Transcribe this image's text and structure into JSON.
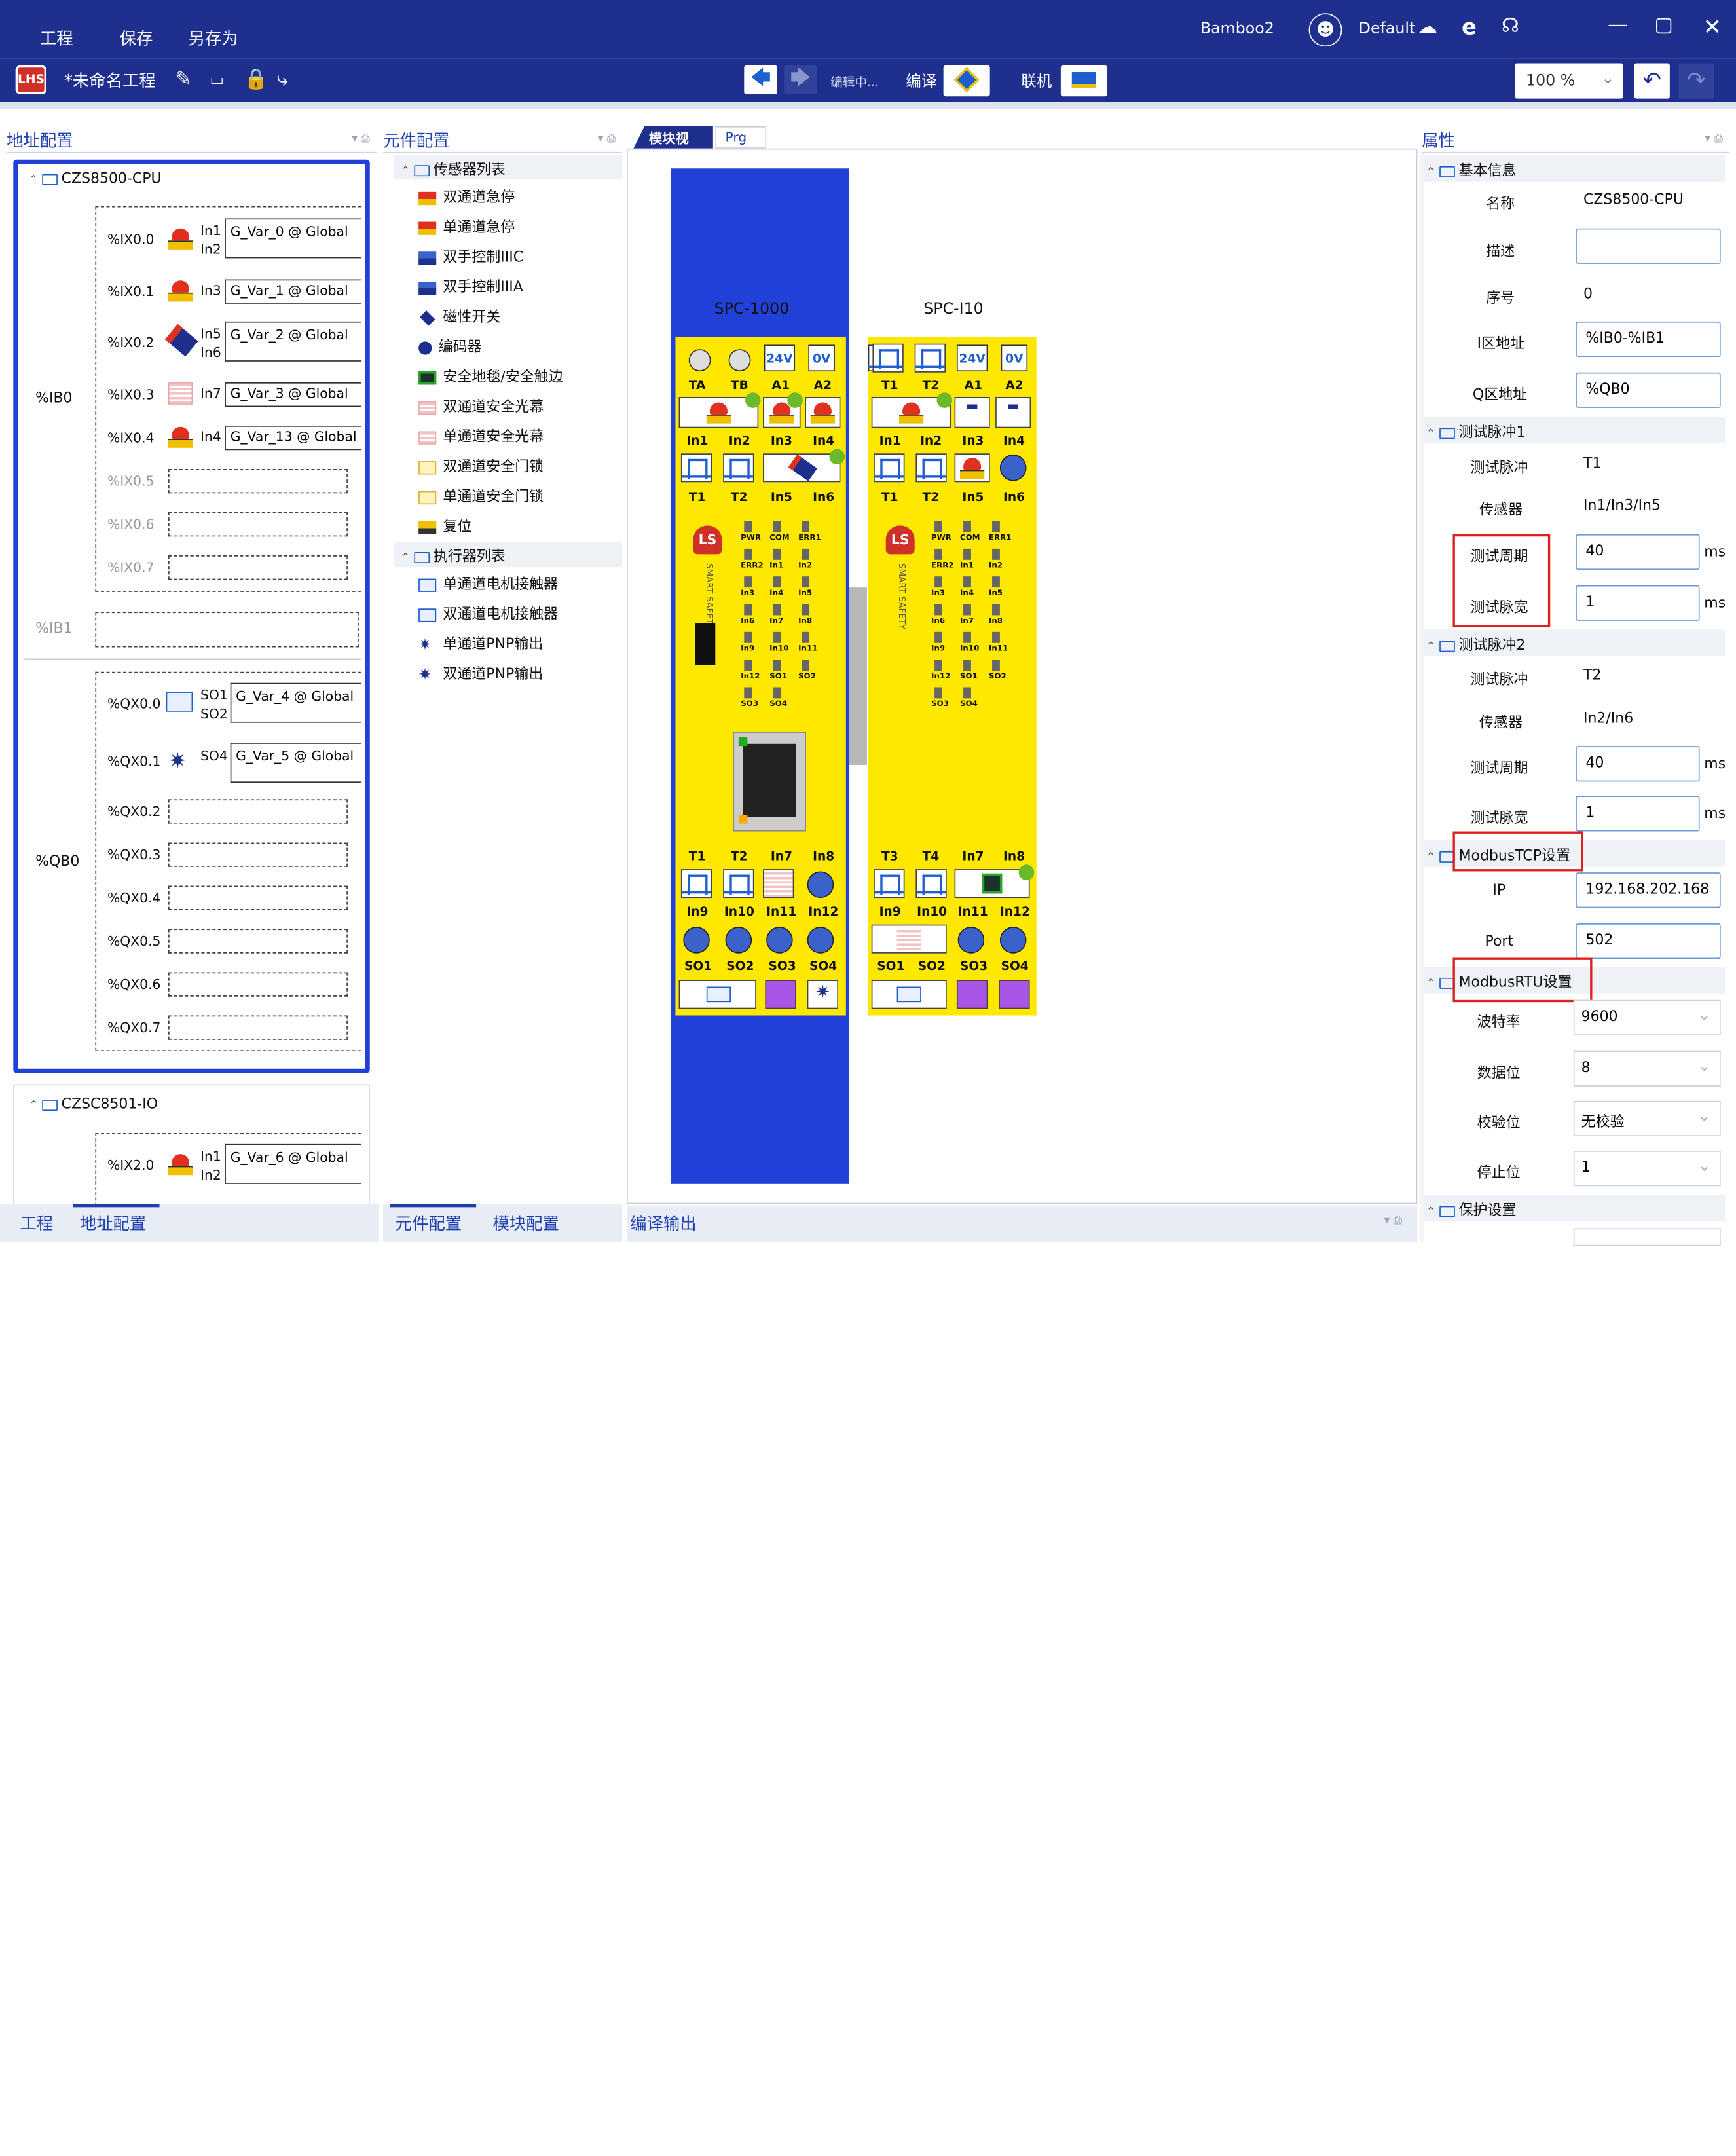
{
  "titlebar": {
    "menu": [
      "工程",
      "保存",
      "另存为"
    ],
    "user": "Bamboo2",
    "profile": "Default",
    "project_title": "*未命名工程",
    "editing": "编辑中...",
    "compile_label": "编译",
    "online_label": "联机",
    "zoom": "100 %"
  },
  "left_panel": {
    "title": "地址配置",
    "cpu_node": "CZS8500-CPU",
    "ib0": "%IB0",
    "ib1": "%IB1",
    "qb0": "%QB0",
    "inputs": [
      {
        "addr": "%IX0.0",
        "pins": [
          "In1",
          "In2"
        ],
        "var": "G_Var_0 @ Global"
      },
      {
        "addr": "%IX0.1",
        "pins": [
          "In3"
        ],
        "var": "G_Var_1 @ Global"
      },
      {
        "addr": "%IX0.2",
        "pins": [
          "In5",
          "In6"
        ],
        "var": "G_Var_2 @ Global"
      },
      {
        "addr": "%IX0.3",
        "pins": [
          "In7"
        ],
        "var": "G_Var_3 @ Global"
      },
      {
        "addr": "%IX0.4",
        "pins": [
          "In4"
        ],
        "var": "G_Var_13 @ Global"
      },
      {
        "addr": "%IX0.5"
      },
      {
        "addr": "%IX0.6"
      },
      {
        "addr": "%IX0.7"
      }
    ],
    "outputs": [
      {
        "addr": "%QX0.0",
        "pins": [
          "SO1",
          "SO2"
        ],
        "var": "G_Var_4 @ Global"
      },
      {
        "addr": "%QX0.1",
        "pins": [
          "SO4"
        ],
        "var": "G_Var_5 @ Global"
      },
      {
        "addr": "%QX0.2"
      },
      {
        "addr": "%QX0.3"
      },
      {
        "addr": "%QX0.4"
      },
      {
        "addr": "%QX0.5"
      },
      {
        "addr": "%QX0.6"
      },
      {
        "addr": "%QX0.7"
      }
    ],
    "io_node": "CZSC8501-IO",
    "io_input": {
      "addr": "%IX2.0",
      "pins": [
        "In1",
        "In2"
      ],
      "var": "G_Var_6 @ Global"
    },
    "tabs": [
      "工程",
      "地址配置"
    ]
  },
  "comp_panel": {
    "title": "元件配置",
    "sensor_group": "传感器列表",
    "sensors": [
      "双通道急停",
      "单通道急停",
      "双手控制IIIC",
      "双手控制IIIA",
      "磁性开关",
      "编码器",
      "安全地毯/安全触边",
      "双通道安全光幕",
      "单通道安全光幕",
      "双通道安全门锁",
      "单通道安全门锁",
      "复位"
    ],
    "actuator_group": "执行器列表",
    "actuators": [
      "单通道电机接触器",
      "双通道电机接触器",
      "单通道PNP输出",
      "双通道PNP输出"
    ],
    "tabs": [
      "元件配置",
      "模块配置"
    ]
  },
  "center": {
    "tabs": [
      "模块视图",
      "Prg"
    ],
    "module1": "SPC-1000",
    "module2": "SPC-I10",
    "bottom_tab": "编译输出",
    "m1_rows": [
      [
        "TA",
        "TB",
        "A1",
        "A2"
      ],
      [
        "In1",
        "In2",
        "In3",
        "In4"
      ],
      [
        "T1",
        "T2",
        "In5",
        "In6"
      ],
      [
        "T1",
        "T2",
        "In7",
        "In8"
      ],
      [
        "In9",
        "In10",
        "In11",
        "In12"
      ],
      [
        "SO1",
        "SO2",
        "SO3",
        "SO4"
      ]
    ],
    "m2_rows": [
      [
        "T1",
        "T2",
        "A1",
        "A2"
      ],
      [
        "In1",
        "In2",
        "In3",
        "In4"
      ],
      [
        "T1",
        "T2",
        "In5",
        "In6"
      ],
      [
        "T3",
        "T4",
        "In7",
        "In8"
      ],
      [
        "In9",
        "In10",
        "In11",
        "In12"
      ],
      [
        "SO1",
        "SO2",
        "SO3",
        "SO4"
      ]
    ],
    "v24": "24V",
    "v0": "0V",
    "leds": [
      "PWR",
      "COM",
      "ERR1",
      "ERR2",
      "In1",
      "In2",
      "In3",
      "In4",
      "In5",
      "In6",
      "In7",
      "In8",
      "In9",
      "In10",
      "In11",
      "In12",
      "SO1",
      "SO2",
      "SO3",
      "SO4"
    ],
    "brand": "SMART SAFETY"
  },
  "props": {
    "title": "属性",
    "basic": "基本信息",
    "name_label": "名称",
    "name_value": "CZS8500-CPU",
    "desc_label": "描述",
    "desc_value": "",
    "seq_label": "序号",
    "seq_value": "0",
    "i_label": "I区地址",
    "i_value": "%IB0-%IB1",
    "q_label": "Q区地址",
    "q_value": "%QB0",
    "tp1": "测试脉冲1",
    "tp1_pulse_label": "测试脉冲",
    "tp1_pulse": "T1",
    "tp1_sensor_label": "传感器",
    "tp1_sensor": "In1/In3/In5",
    "tp1_period_label": "测试周期",
    "tp1_period": "40",
    "tp1_width_label": "测试脉宽",
    "tp1_width": "1",
    "tp2": "测试脉冲2",
    "tp2_pulse_label": "测试脉冲",
    "tp2_pulse": "T2",
    "tp2_sensor_label": "传感器",
    "tp2_sensor": "In2/In6",
    "tp2_period_label": "测试周期",
    "tp2_period": "40",
    "tp2_width_label": "测试脉宽",
    "tp2_width": "1",
    "ms": "ms",
    "tcp": "ModbusTCP设置",
    "ip_label": "IP",
    "ip": "192.168.202.168",
    "port_label": "Port",
    "port": "502",
    "rtu": "ModbusRTU设置",
    "baud_label": "波特率",
    "baud": "9600",
    "data_label": "数据位",
    "data": "8",
    "parity_label": "校验位",
    "parity": "无校验",
    "stop_label": "停止位",
    "stop": "1",
    "protect": "保护设置"
  },
  "colors": {
    "header": "#1e2f8e",
    "accent": "#1e3fb0",
    "module_yellow": "#ffe800",
    "rail_blue": "#2040d8",
    "highlight_red": "#e02020"
  }
}
